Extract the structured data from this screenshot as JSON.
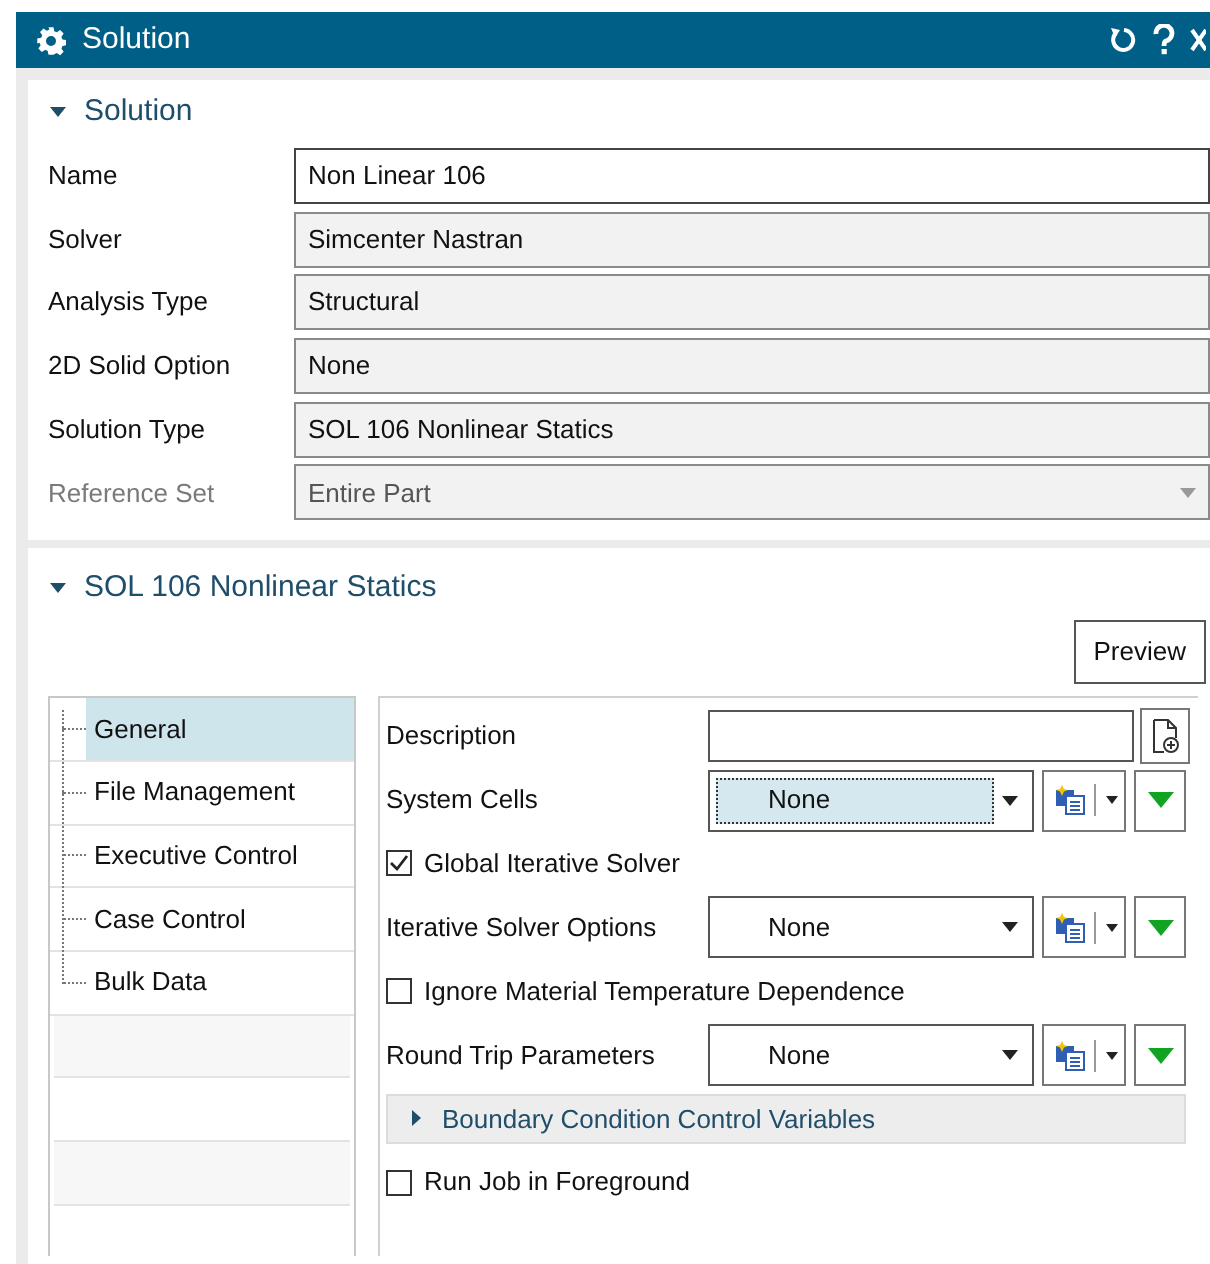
{
  "window": {
    "title": "Solution"
  },
  "solution_section": {
    "title": "Solution",
    "expanded": true,
    "fields": [
      {
        "label": "Name",
        "value": "Non Linear 106",
        "kind": "input",
        "disabled": false
      },
      {
        "label": "Solver",
        "value": "Simcenter Nastran",
        "kind": "readonly",
        "disabled": false
      },
      {
        "label": "Analysis Type",
        "value": "Structural",
        "kind": "readonly",
        "disabled": false
      },
      {
        "label": "2D Solid Option",
        "value": "None",
        "kind": "readonly",
        "disabled": false
      },
      {
        "label": "Solution Type",
        "value": "SOL 106 Nonlinear Statics",
        "kind": "readonly",
        "disabled": false
      },
      {
        "label": "Reference Set",
        "value": "Entire Part",
        "kind": "dropdown",
        "disabled": true
      }
    ]
  },
  "sol_section": {
    "title": "SOL 106 Nonlinear Statics",
    "expanded": true,
    "preview_button": "Preview",
    "tree": [
      {
        "label": "General",
        "selected": true
      },
      {
        "label": "File Management",
        "selected": false
      },
      {
        "label": "Executive Control",
        "selected": false
      },
      {
        "label": "Case Control",
        "selected": false
      },
      {
        "label": "Bulk Data",
        "selected": false
      }
    ],
    "options": [
      {
        "kind": "text_field",
        "label": "Description"
      },
      {
        "kind": "selector",
        "label": "System Cells",
        "value": "None",
        "focused": true
      },
      {
        "kind": "checkbox",
        "label": "Global Iterative Solver",
        "checked": true
      },
      {
        "kind": "selector",
        "label": "Iterative Solver Options",
        "value": "None",
        "focused": false
      },
      {
        "kind": "checkbox",
        "label": "Ignore Material Temperature Dependence",
        "checked": false
      },
      {
        "kind": "selector",
        "label": "Round Trip Parameters",
        "value": "None",
        "focused": false
      },
      {
        "kind": "group",
        "label": "Boundary Condition Control Variables",
        "expanded": false
      },
      {
        "kind": "checkbox",
        "label": "Run Job in Foreground",
        "checked": false
      }
    ]
  }
}
